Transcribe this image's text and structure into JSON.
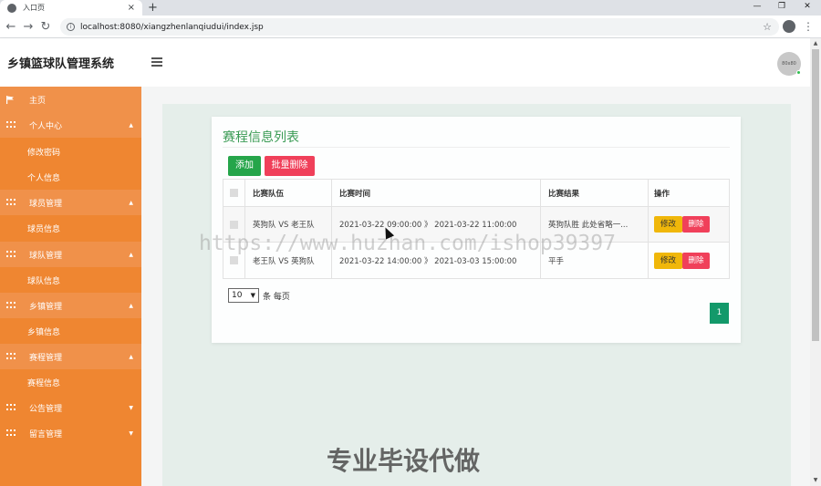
{
  "browser": {
    "tab_title": "入口页",
    "tab_close": "×",
    "new_tab": "+",
    "url": "localhost:8080/xiangzhenlanqiudui/index.jsp",
    "win_min": "—",
    "win_restore": "❐",
    "win_close": "✕"
  },
  "header": {
    "app_title": "乡镇篮球队管理系统",
    "avatar_text": "80x80"
  },
  "sidebar": {
    "items": [
      {
        "label": "主页",
        "type": "first"
      },
      {
        "label": "个人中心",
        "type": "head"
      },
      {
        "label": "修改密码",
        "type": "sub"
      },
      {
        "label": "个人信息",
        "type": "sub"
      },
      {
        "label": "球员管理",
        "type": "head"
      },
      {
        "label": "球员信息",
        "type": "sub"
      },
      {
        "label": "球队管理",
        "type": "head"
      },
      {
        "label": "球队信息",
        "type": "sub"
      },
      {
        "label": "乡镇管理",
        "type": "head"
      },
      {
        "label": "乡镇信息",
        "type": "sub"
      },
      {
        "label": "赛程管理",
        "type": "head"
      },
      {
        "label": "赛程信息",
        "type": "sub"
      },
      {
        "label": "公告管理",
        "type": "collapsed"
      },
      {
        "label": "留言管理",
        "type": "collapsed"
      }
    ]
  },
  "main": {
    "title": "赛程信息列表",
    "add_label": "添加",
    "batch_delete_label": "批量删除",
    "columns": [
      "比赛队伍",
      "比赛时间",
      "比赛结果",
      "操作"
    ],
    "rows": [
      {
        "team": "英狗队 VS 老王队",
        "time": "2021-03-22 09:00:00 》 2021-03-22 11:00:00",
        "result": "英狗队胜 此处省略一...",
        "edit": "修改",
        "delete": "删除"
      },
      {
        "team": "老王队 VS 英狗队",
        "time": "2021-03-22 14:00:00 》 2021-03-03 15:00:00",
        "result": "平手",
        "edit": "修改",
        "delete": "删除"
      }
    ],
    "page_size": "10",
    "page_size_label": "条 每页",
    "current_page": "1"
  },
  "watermark": {
    "url": "https://www.huzhan.com/ishop39397",
    "text": "专业毕设代做"
  },
  "colors": {
    "sidebar": "#ef8631",
    "accent_green": "#25a54a",
    "danger": "#f0405a",
    "warning": "#f0b70a",
    "title_green": "#3a9b54",
    "page_active": "#13996a"
  }
}
